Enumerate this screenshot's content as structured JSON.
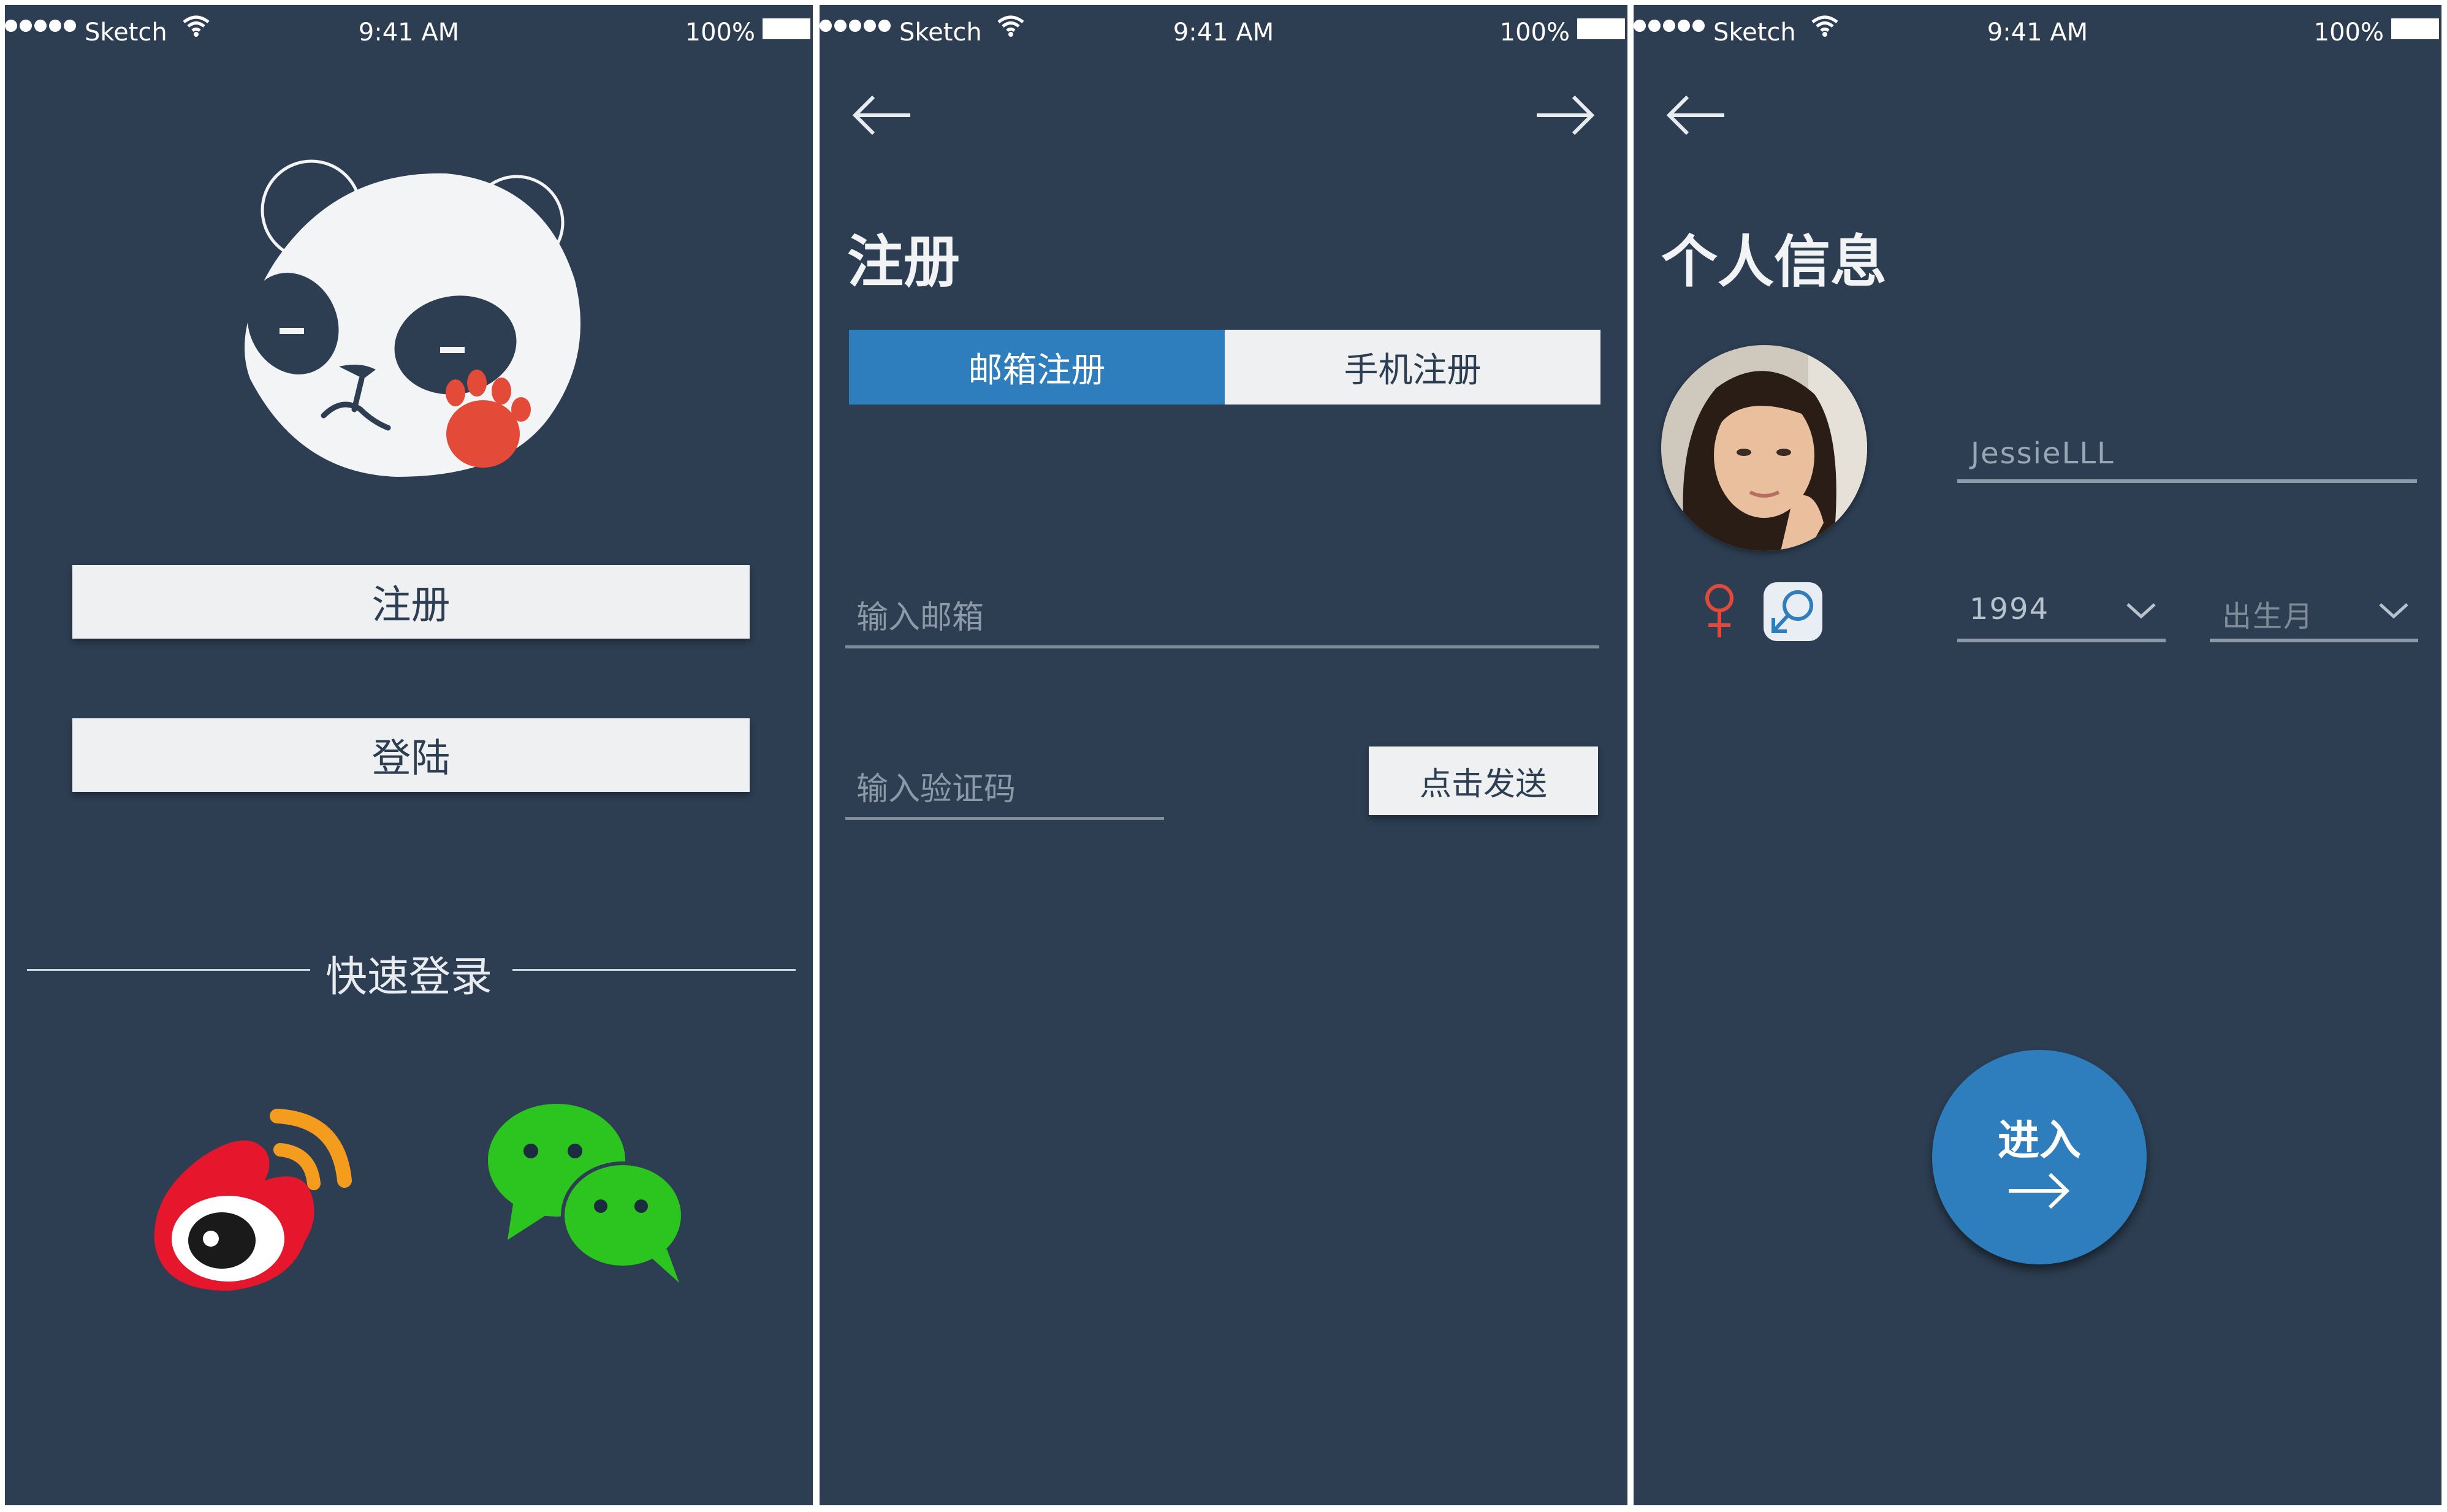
{
  "statusbar": {
    "carrier": "Sketch",
    "time": "9:41 AM",
    "battery": "100%"
  },
  "screen1": {
    "register_label": "注册",
    "login_label": "登陆",
    "quick_login_label": "快速登录"
  },
  "screen2": {
    "title": "注册",
    "tabs": [
      {
        "label": "邮箱注册",
        "active": true
      },
      {
        "label": "手机注册",
        "active": false
      }
    ],
    "email_placeholder": "输入邮箱",
    "code_placeholder": "输入验证码",
    "send_label": "点击发送"
  },
  "screen3": {
    "title": "个人信息",
    "username": "JessieLLL",
    "year": "1994",
    "month_placeholder": "出生月",
    "enter_label": "进入"
  },
  "colors": {
    "background": "#2d3e52",
    "accent": "#2e7dbd",
    "button_light": "#eef0f1",
    "female": "#e04a3a"
  },
  "icons": [
    "wifi-icon",
    "battery-icon",
    "panda-logo",
    "back-arrow-icon",
    "forward-arrow-icon",
    "weibo-icon",
    "wechat-icon",
    "female-icon",
    "male-icon",
    "chevron-down-icon",
    "right-arrow-icon"
  ]
}
